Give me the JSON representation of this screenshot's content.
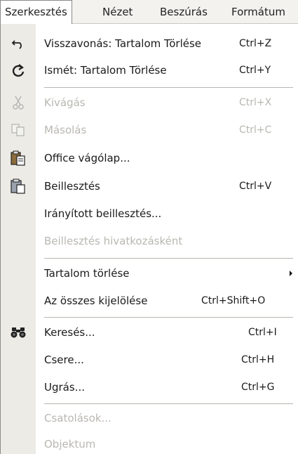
{
  "menubar": {
    "items": [
      {
        "label": "Szerkesztés"
      },
      {
        "label": "Nézet"
      },
      {
        "label": "Beszúrás"
      },
      {
        "label": "Formátum"
      }
    ]
  },
  "menu": {
    "items": [
      {
        "label": "Visszavonás: Tartalom Törlése",
        "shortcut": "Ctrl+Z",
        "icon": "undo-icon",
        "disabled": false
      },
      {
        "label": "Ismét: Tartalom Törlése",
        "shortcut": "Ctrl+Y",
        "icon": "redo-icon",
        "disabled": false
      },
      {
        "label": "Kivágás",
        "shortcut": "Ctrl+X",
        "icon": "scissors-icon",
        "disabled": true
      },
      {
        "label": "Másolás",
        "shortcut": "Ctrl+C",
        "icon": "copy-icon",
        "disabled": true
      },
      {
        "label": "Office vágólap...",
        "shortcut": "",
        "icon": "clipboard-icon",
        "disabled": false
      },
      {
        "label": "Beillesztés",
        "shortcut": "Ctrl+V",
        "icon": "paste-icon",
        "disabled": false
      },
      {
        "label": "Irányított beillesztés...",
        "shortcut": "",
        "icon": "",
        "disabled": false
      },
      {
        "label": "Beillesztés hivatkozásként",
        "shortcut": "",
        "icon": "",
        "disabled": true
      },
      {
        "label": "Tartalom törlése",
        "shortcut": "",
        "icon": "",
        "disabled": false,
        "submenu": true
      },
      {
        "label": "Az összes kijelölése",
        "shortcut": "Ctrl+Shift+O",
        "icon": "",
        "disabled": false
      },
      {
        "label": "Keresés...",
        "shortcut": "Ctrl+I",
        "icon": "binoculars-icon",
        "disabled": false
      },
      {
        "label": "Csere...",
        "shortcut": "Ctrl+H",
        "icon": "",
        "disabled": false
      },
      {
        "label": "Ugrás...",
        "shortcut": "Ctrl+G",
        "icon": "",
        "disabled": false
      },
      {
        "label": "Csatolások...",
        "shortcut": "",
        "icon": "",
        "disabled": true
      },
      {
        "label": "Objektum",
        "shortcut": "",
        "icon": "",
        "disabled": true
      }
    ]
  },
  "colors": {
    "menubar_bg": "#f3f2ee",
    "icon_strip_bg": "#ecebe6",
    "disabled_text": "#b9b7b2"
  }
}
